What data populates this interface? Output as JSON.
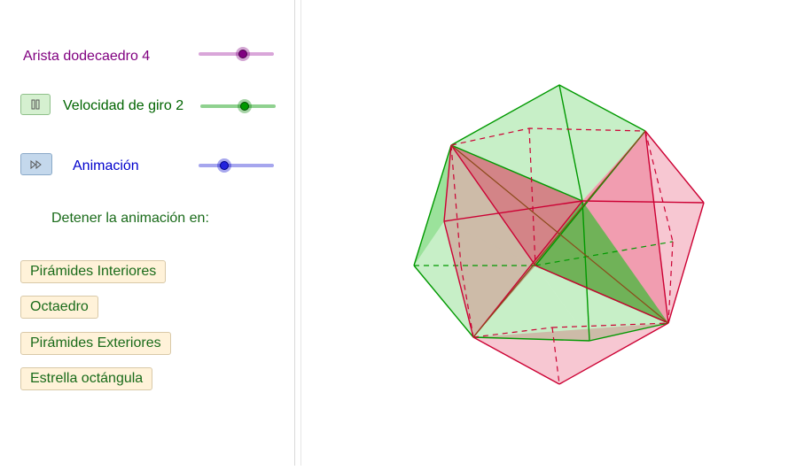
{
  "sliders": {
    "edge": {
      "label": "Arista dodecaedro 4",
      "min": 0,
      "max": 10,
      "value": 4,
      "color": "#800080"
    },
    "speed": {
      "label": "Velocidad de giro 2",
      "value": 2,
      "color": "#006400"
    },
    "animation": {
      "label": "Animación",
      "color": "#0000cc"
    }
  },
  "controls": {
    "speed_button_icon": "pause-icon",
    "animation_button_icon": "play-icon"
  },
  "stop_heading": "Detener la animación en:",
  "buttons": [
    "Pirámides Interiores",
    "Octaedro",
    "Pirámides Exteriores",
    "Estrella octángula"
  ],
  "colors": {
    "green_face": "#00b400",
    "red_face": "#e0204a",
    "green_edge": "#009900",
    "red_edge": "#cc0033"
  }
}
